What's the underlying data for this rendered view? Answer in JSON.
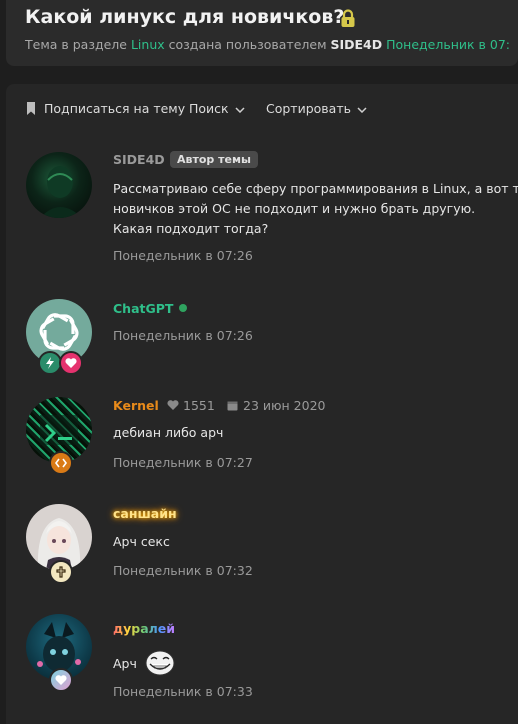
{
  "topic": {
    "title": "Какой линукс для новичков?",
    "subtitle_prefix": "Тема в разделе",
    "section": "Linux",
    "created_by": "создана пользователем",
    "author": "SIDE4D",
    "date": "Понедельник в 07:"
  },
  "toolbar": {
    "subscribe_label": "Подписаться на тему",
    "search_label": "Поиск",
    "sort_label": "Сортировать"
  },
  "posts": [
    {
      "username": "SIDE4D",
      "badge": "Автор темы",
      "message_lines": [
        "Рассматриваю себе сферу программирования в Linux, а вот тол",
        "новичков этой ОС не подходит и нужно брать другую.",
        "Какая подходит тогда?"
      ],
      "time": "Понедельник в 07:26"
    },
    {
      "username": "ChatGPT",
      "time": "Понедельник в 07:26"
    },
    {
      "username": "Kernel",
      "likes": "1551",
      "joined": "23 июн 2020",
      "message": "дебиан либо арч",
      "time": "Понедельник в 07:27"
    },
    {
      "username": "саншайн",
      "message": "Арч секс",
      "time": "Понедельник в 07:32"
    },
    {
      "username": "дуралей",
      "message": "Арч",
      "time": "Понедельник в 07:33"
    }
  ],
  "colors": {
    "accent_green": "#2fbf8a",
    "kernel_orange": "#e88a1a",
    "background": "#1e1e1e"
  }
}
